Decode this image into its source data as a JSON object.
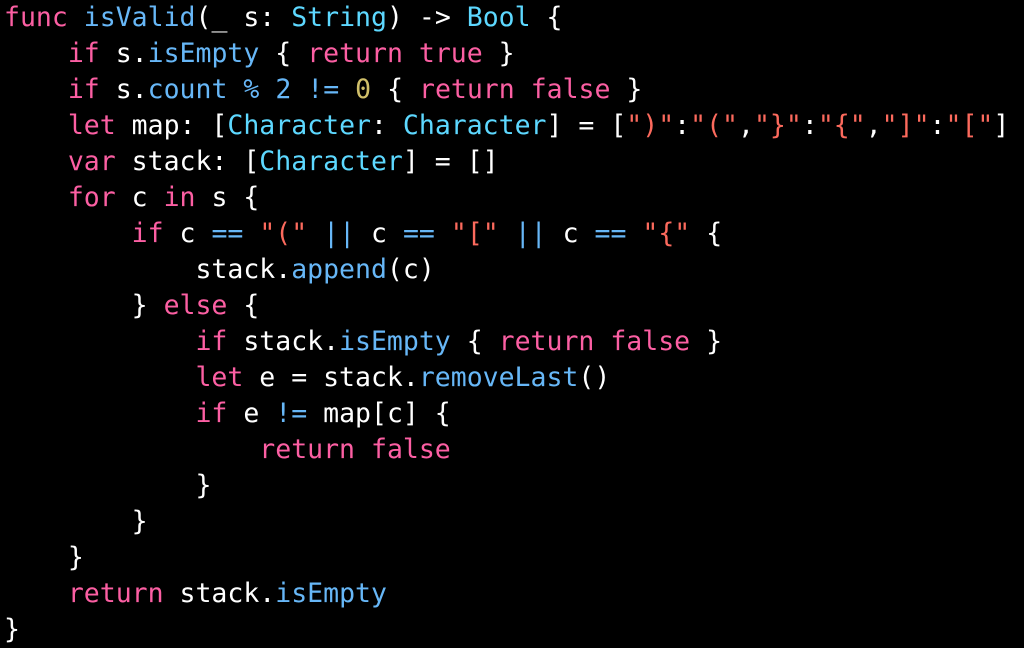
{
  "editor": {
    "language": "Swift",
    "theme": {
      "background": "#000000",
      "colors": {
        "plain": "#ffffff",
        "keyword": "#fc5fa3",
        "type": "#5dd8ff",
        "function": "#67b7f7",
        "member": "#67b7f7",
        "number": "#d0bf69",
        "string": "#fc6a5d"
      }
    },
    "lines": [
      {
        "indent": 0,
        "tokens": [
          {
            "t": "func",
            "k": "keyword"
          },
          {
            "t": " ",
            "k": "plain"
          },
          {
            "t": "isValid",
            "k": "function"
          },
          {
            "t": "(_ s: ",
            "k": "plain"
          },
          {
            "t": "String",
            "k": "type"
          },
          {
            "t": ") -> ",
            "k": "plain"
          },
          {
            "t": "Bool",
            "k": "type"
          },
          {
            "t": " {",
            "k": "plain"
          }
        ]
      },
      {
        "indent": 1,
        "tokens": [
          {
            "t": "if",
            "k": "keyword"
          },
          {
            "t": " s.",
            "k": "plain"
          },
          {
            "t": "isEmpty",
            "k": "member"
          },
          {
            "t": " { ",
            "k": "plain"
          },
          {
            "t": "return",
            "k": "keyword"
          },
          {
            "t": " ",
            "k": "plain"
          },
          {
            "t": "true",
            "k": "keyword"
          },
          {
            "t": " }",
            "k": "plain"
          }
        ]
      },
      {
        "indent": 1,
        "tokens": [
          {
            "t": "if",
            "k": "keyword"
          },
          {
            "t": " s.",
            "k": "plain"
          },
          {
            "t": "count",
            "k": "member"
          },
          {
            "t": " ",
            "k": "plain"
          },
          {
            "t": "%",
            "k": "member"
          },
          {
            "t": " ",
            "k": "plain"
          },
          {
            "t": "2",
            "k": "member"
          },
          {
            "t": " ",
            "k": "plain"
          },
          {
            "t": "!=",
            "k": "member"
          },
          {
            "t": " ",
            "k": "plain"
          },
          {
            "t": "0",
            "k": "number"
          },
          {
            "t": " { ",
            "k": "plain"
          },
          {
            "t": "return",
            "k": "keyword"
          },
          {
            "t": " ",
            "k": "plain"
          },
          {
            "t": "false",
            "k": "keyword"
          },
          {
            "t": " }",
            "k": "plain"
          }
        ]
      },
      {
        "indent": 1,
        "tokens": [
          {
            "t": "let",
            "k": "keyword"
          },
          {
            "t": " map: [",
            "k": "plain"
          },
          {
            "t": "Character",
            "k": "type"
          },
          {
            "t": ": ",
            "k": "plain"
          },
          {
            "t": "Character",
            "k": "type"
          },
          {
            "t": "] = [",
            "k": "plain"
          },
          {
            "t": "\")\"",
            "k": "string"
          },
          {
            "t": ":",
            "k": "plain"
          },
          {
            "t": "\"(\"",
            "k": "string"
          },
          {
            "t": ",",
            "k": "plain"
          },
          {
            "t": "\"}\"",
            "k": "string"
          },
          {
            "t": ":",
            "k": "plain"
          },
          {
            "t": "\"{\"",
            "k": "string"
          },
          {
            "t": ",",
            "k": "plain"
          },
          {
            "t": "\"]\"",
            "k": "string"
          },
          {
            "t": ":",
            "k": "plain"
          },
          {
            "t": "\"[\"",
            "k": "string"
          },
          {
            "t": "]",
            "k": "plain"
          }
        ]
      },
      {
        "indent": 1,
        "tokens": [
          {
            "t": "var",
            "k": "keyword"
          },
          {
            "t": " stack: [",
            "k": "plain"
          },
          {
            "t": "Character",
            "k": "type"
          },
          {
            "t": "] = []",
            "k": "plain"
          }
        ]
      },
      {
        "indent": 1,
        "tokens": [
          {
            "t": "for",
            "k": "keyword"
          },
          {
            "t": " c ",
            "k": "plain"
          },
          {
            "t": "in",
            "k": "keyword"
          },
          {
            "t": " s {",
            "k": "plain"
          }
        ]
      },
      {
        "indent": 2,
        "tokens": [
          {
            "t": "if",
            "k": "keyword"
          },
          {
            "t": " c ",
            "k": "plain"
          },
          {
            "t": "==",
            "k": "member"
          },
          {
            "t": " ",
            "k": "plain"
          },
          {
            "t": "\"(\"",
            "k": "string"
          },
          {
            "t": " ",
            "k": "plain"
          },
          {
            "t": "||",
            "k": "member"
          },
          {
            "t": " c ",
            "k": "plain"
          },
          {
            "t": "==",
            "k": "member"
          },
          {
            "t": " ",
            "k": "plain"
          },
          {
            "t": "\"[\"",
            "k": "string"
          },
          {
            "t": " ",
            "k": "plain"
          },
          {
            "t": "||",
            "k": "member"
          },
          {
            "t": " c ",
            "k": "plain"
          },
          {
            "t": "==",
            "k": "member"
          },
          {
            "t": " ",
            "k": "plain"
          },
          {
            "t": "\"{\"",
            "k": "string"
          },
          {
            "t": " {",
            "k": "plain"
          }
        ]
      },
      {
        "indent": 3,
        "tokens": [
          {
            "t": "stack.",
            "k": "plain"
          },
          {
            "t": "append",
            "k": "member"
          },
          {
            "t": "(c)",
            "k": "plain"
          }
        ]
      },
      {
        "indent": 2,
        "tokens": [
          {
            "t": "} ",
            "k": "plain"
          },
          {
            "t": "else",
            "k": "keyword"
          },
          {
            "t": " {",
            "k": "plain"
          }
        ]
      },
      {
        "indent": 3,
        "tokens": [
          {
            "t": "if",
            "k": "keyword"
          },
          {
            "t": " stack.",
            "k": "plain"
          },
          {
            "t": "isEmpty",
            "k": "member"
          },
          {
            "t": " { ",
            "k": "plain"
          },
          {
            "t": "return",
            "k": "keyword"
          },
          {
            "t": " ",
            "k": "plain"
          },
          {
            "t": "false",
            "k": "keyword"
          },
          {
            "t": " }",
            "k": "plain"
          }
        ]
      },
      {
        "indent": 3,
        "tokens": [
          {
            "t": "let",
            "k": "keyword"
          },
          {
            "t": " e = stack.",
            "k": "plain"
          },
          {
            "t": "removeLast",
            "k": "member"
          },
          {
            "t": "()",
            "k": "plain"
          }
        ]
      },
      {
        "indent": 3,
        "tokens": [
          {
            "t": "if",
            "k": "keyword"
          },
          {
            "t": " e ",
            "k": "plain"
          },
          {
            "t": "!=",
            "k": "member"
          },
          {
            "t": " map[c] {",
            "k": "plain"
          }
        ]
      },
      {
        "indent": 4,
        "tokens": [
          {
            "t": "return",
            "k": "keyword"
          },
          {
            "t": " ",
            "k": "plain"
          },
          {
            "t": "false",
            "k": "keyword"
          }
        ]
      },
      {
        "indent": 3,
        "tokens": [
          {
            "t": "}",
            "k": "plain"
          }
        ]
      },
      {
        "indent": 2,
        "tokens": [
          {
            "t": "}",
            "k": "plain"
          }
        ]
      },
      {
        "indent": 1,
        "tokens": [
          {
            "t": "}",
            "k": "plain"
          }
        ]
      },
      {
        "indent": 1,
        "tokens": [
          {
            "t": "return",
            "k": "keyword"
          },
          {
            "t": " stack.",
            "k": "plain"
          },
          {
            "t": "isEmpty",
            "k": "member"
          }
        ]
      },
      {
        "indent": 0,
        "tokens": [
          {
            "t": "}",
            "k": "plain"
          }
        ]
      }
    ]
  }
}
